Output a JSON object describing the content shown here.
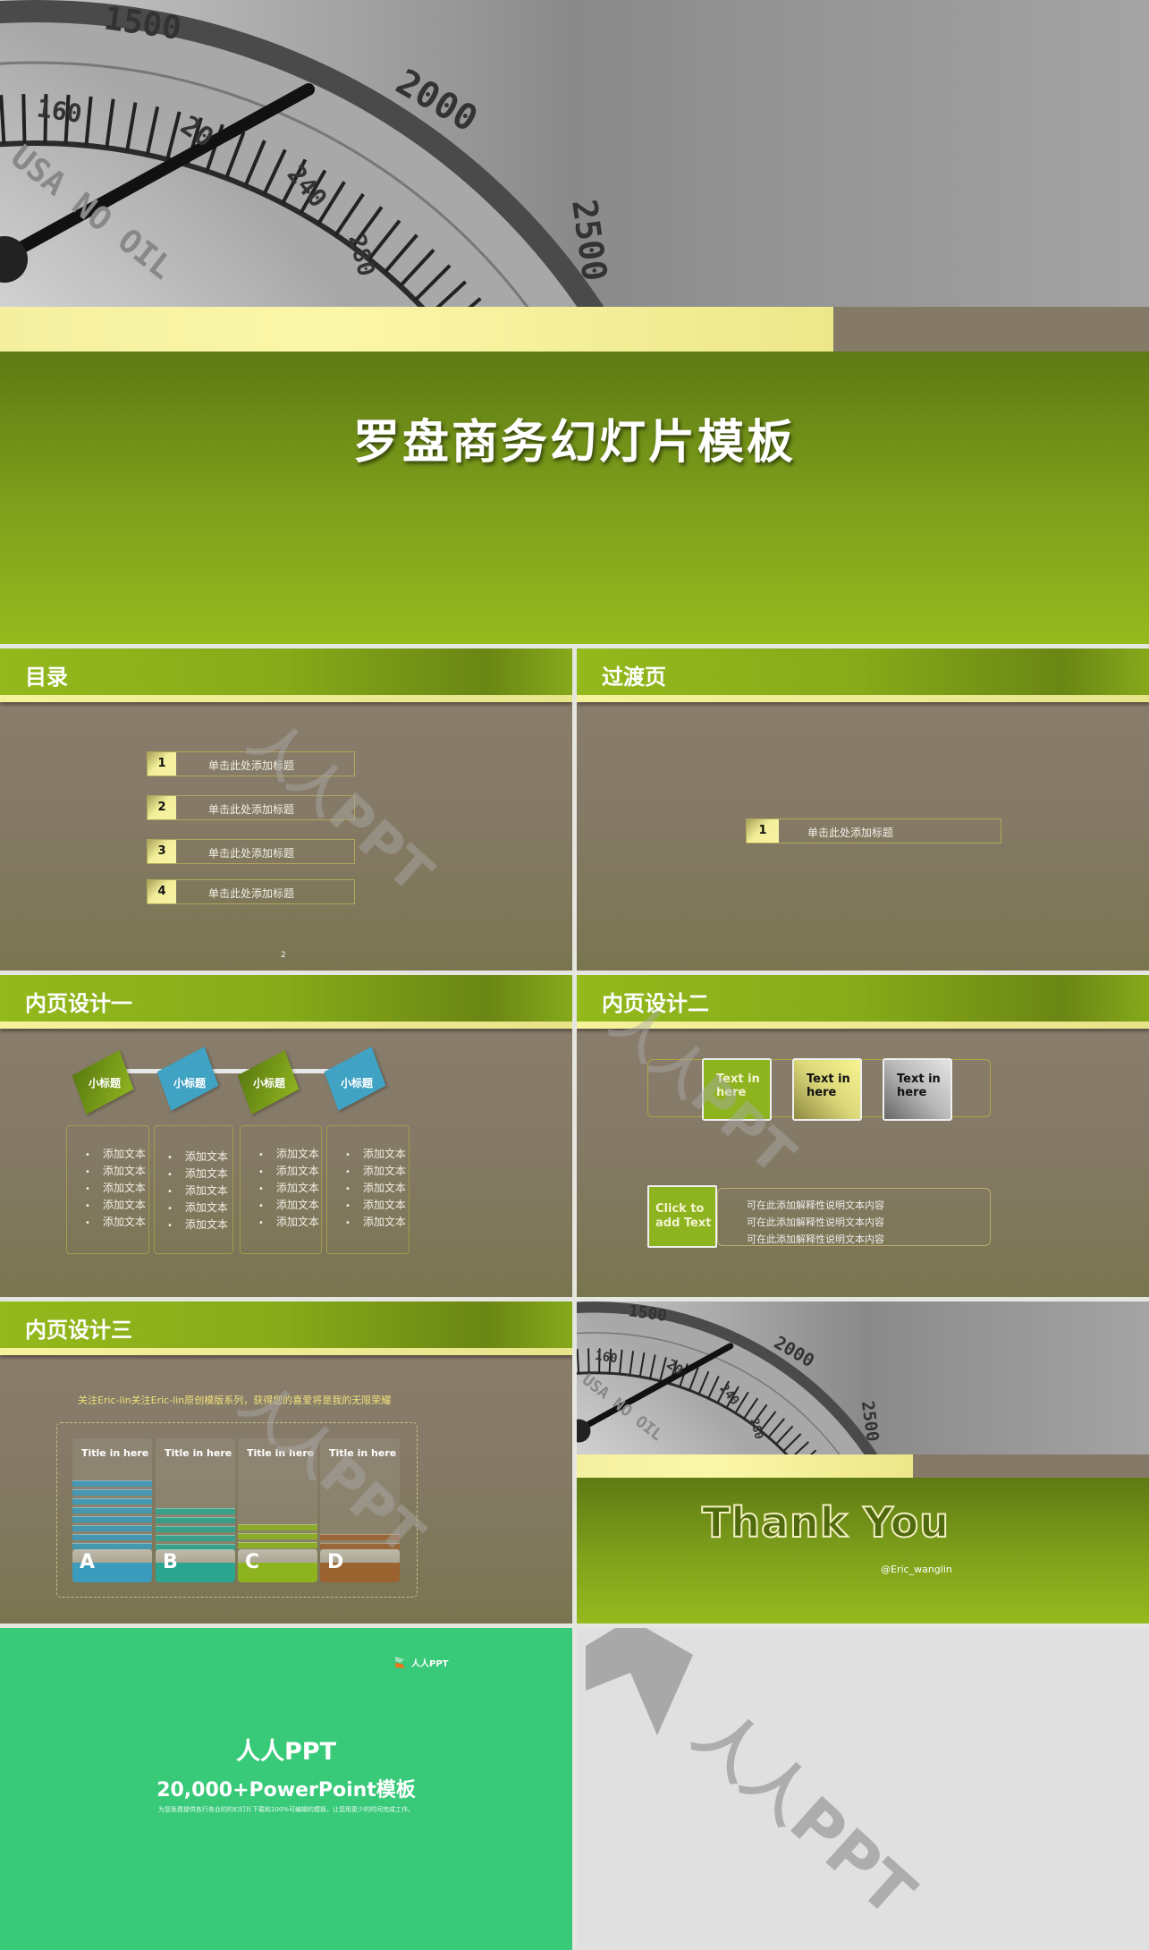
{
  "gauge": {
    "n1500": "1500",
    "n2000": "2000",
    "n2500": "2500",
    "n160": "160",
    "n20": "20",
    "n240": "240",
    "n280": "280",
    "brand": "USA NO OIL"
  },
  "cover": {
    "title": "罗盘商务幻灯片模板"
  },
  "watermark": "人人PPT",
  "toc": {
    "title": "目录",
    "items": [
      {
        "num": "1",
        "label": "单击此处添加标题"
      },
      {
        "num": "2",
        "label": "单击此处添加标题"
      },
      {
        "num": "3",
        "label": "单击此处添加标题"
      },
      {
        "num": "4",
        "label": "单击此处添加标题"
      }
    ],
    "page": "2"
  },
  "transition": {
    "title": "过渡页",
    "item": {
      "num": "1",
      "label": "单击此处添加标题"
    }
  },
  "design1": {
    "title": "内页设计一",
    "tags": [
      "小标题",
      "小标题",
      "小标题",
      "小标题"
    ],
    "bullet": "添加文本"
  },
  "design2": {
    "title": "内页设计二",
    "boxes": [
      "Text in here",
      "Text in here",
      "Text in here"
    ],
    "click": "Click to add Text",
    "lines": [
      "可在此添加解释性说明文本内容",
      "可在此添加解释性说明文本内容",
      "可在此添加解释性说明文本内容"
    ]
  },
  "design3": {
    "title": "内页设计三",
    "caption": "关注Eric-lin关注Eric-lin原创模版系列，获得您的喜爱将是我的无限荣耀",
    "columns": [
      {
        "title": "Title in here",
        "letter": "A",
        "color": "#3a9bbd"
      },
      {
        "title": "Title in here",
        "letter": "B",
        "color": "#2aa58f"
      },
      {
        "title": "Title in here",
        "letter": "C",
        "color": "#8db31f"
      },
      {
        "title": "Title in here",
        "letter": "D",
        "color": "#9a6330"
      }
    ]
  },
  "thanks": {
    "title": "Thank You",
    "handle": "@Eric_wanglin"
  },
  "ad": {
    "logo": "人人PPT",
    "title": "人人PPT",
    "subtitle": "20,000+PowerPoint模板",
    "desc": "为您免费提供各行各业的的幻灯片下载和100%可编辑的模板，让您用更少的时间完成工作。"
  },
  "colors": {
    "green": "#8db31f",
    "brown": "#857a67",
    "yellow": "#f6f29c",
    "ad_green": "#38c979"
  }
}
